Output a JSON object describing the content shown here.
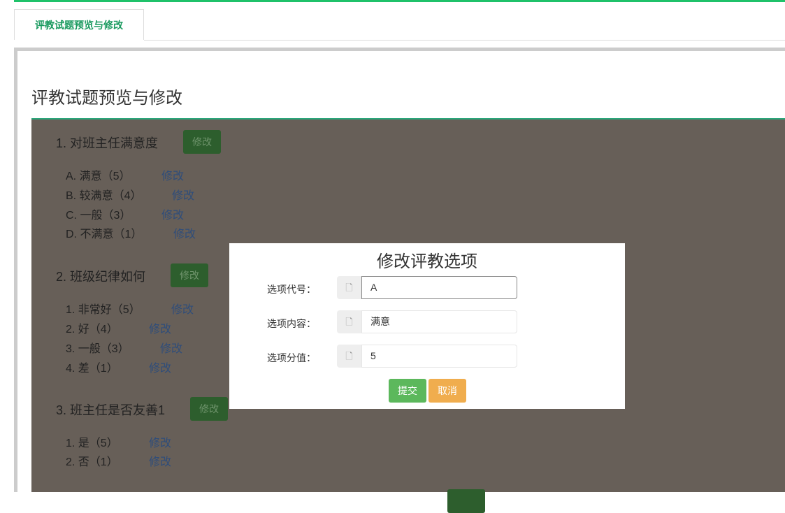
{
  "tab": {
    "label": "评教试题预览与修改"
  },
  "page_title": "评教试题预览与修改",
  "edit_label": "修改",
  "questions": [
    {
      "title": "1. 对班主任满意度",
      "options": [
        "A. 满意（5）",
        "B. 较满意（4）",
        "C. 一般（3）",
        "D. 不满意（1）"
      ]
    },
    {
      "title": "2. 班级纪律如何",
      "options": [
        "1. 非常好（5）",
        "2. 好（4）",
        "3. 一般（3）",
        "4. 差（1）"
      ]
    },
    {
      "title": "3. 班主任是否友善1",
      "options": [
        "1. 是（5）",
        "2. 否（1）"
      ]
    }
  ],
  "modal": {
    "title": "修改评教选项",
    "fields": [
      {
        "label": "选项代号：",
        "value": "A"
      },
      {
        "label": "选项内容：",
        "value": "满意"
      },
      {
        "label": "选项分值：",
        "value": "5"
      }
    ],
    "submit": "提交",
    "cancel": "取消"
  },
  "colors": {
    "accent": "#1fc26a",
    "submit": "#5cb85c",
    "cancel": "#f0ad4e"
  }
}
